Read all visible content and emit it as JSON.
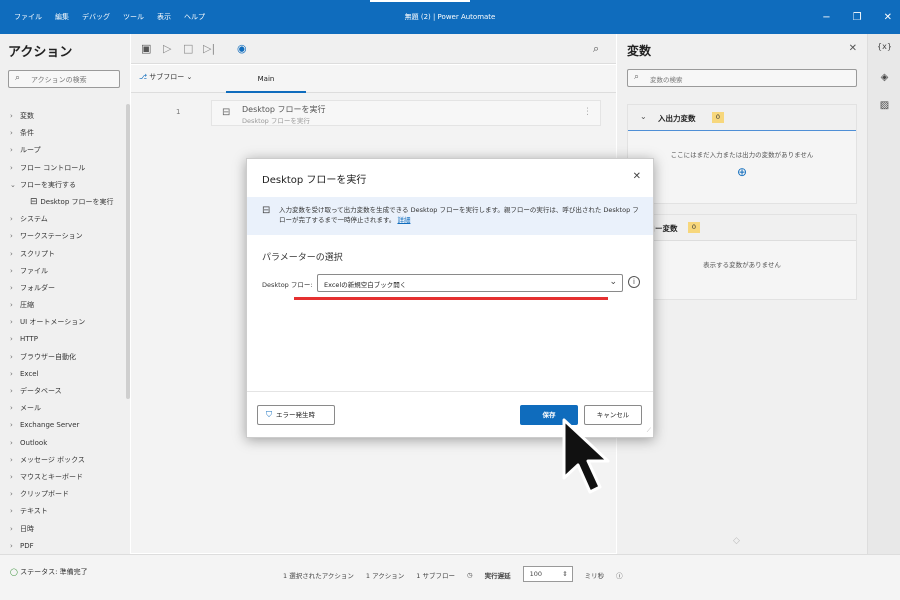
{
  "titlebar": {
    "menu": [
      "ファイル",
      "編集",
      "デバッグ",
      "ツール",
      "表示",
      "ヘルプ"
    ],
    "title": "無題 (2) | Power Automate",
    "controls": [
      "−",
      "❐",
      "✕"
    ]
  },
  "actions_panel": {
    "title": "アクション",
    "search_placeholder": "アクションの検索",
    "items": [
      {
        "label": "変数",
        "chev": "›"
      },
      {
        "label": "条件",
        "chev": "›"
      },
      {
        "label": "ループ",
        "chev": "›"
      },
      {
        "label": "フロー コントロール",
        "chev": "›"
      },
      {
        "label": "フローを実行する",
        "chev": "⌄"
      },
      {
        "label": "Desktop フローを実行",
        "chev": "",
        "sub": true
      },
      {
        "label": "システム",
        "chev": "›"
      },
      {
        "label": "ワークステーション",
        "chev": "›"
      },
      {
        "label": "スクリプト",
        "chev": "›"
      },
      {
        "label": "ファイル",
        "chev": "›"
      },
      {
        "label": "フォルダー",
        "chev": "›"
      },
      {
        "label": "圧縮",
        "chev": "›"
      },
      {
        "label": "UI オートメーション",
        "chev": "›"
      },
      {
        "label": "HTTP",
        "chev": "›"
      },
      {
        "label": "ブラウザー自動化",
        "chev": "›"
      },
      {
        "label": "Excel",
        "chev": "›"
      },
      {
        "label": "データベース",
        "chev": "›"
      },
      {
        "label": "メール",
        "chev": "›"
      },
      {
        "label": "Exchange Server",
        "chev": "›"
      },
      {
        "label": "Outlook",
        "chev": "›"
      },
      {
        "label": "メッセージ ボックス",
        "chev": "›"
      },
      {
        "label": "マウスとキーボード",
        "chev": "›"
      },
      {
        "label": "クリップボード",
        "chev": "›"
      },
      {
        "label": "テキスト",
        "chev": "›"
      },
      {
        "label": "日時",
        "chev": "›"
      },
      {
        "label": "PDF",
        "chev": "›"
      }
    ]
  },
  "editor": {
    "subflow_label": "サブフロー",
    "tab_main": "Main",
    "line_number": "1",
    "step_title": "Desktop フローを実行",
    "step_subtitle": "Desktop フローを実行"
  },
  "variables_panel": {
    "title": "変数",
    "search_placeholder": "変数の検索",
    "io_section": {
      "label": "入出力変数",
      "count": "0",
      "empty": "ここにはまだ入力または出力の変数がありません"
    },
    "flow_section": {
      "label": "フロー変数",
      "count": "0",
      "empty": "表示する変数がありません"
    }
  },
  "rail": {
    "vars_label": "{x}"
  },
  "statusbar": {
    "status": "ステータス: 準備完了",
    "selected": "1 選択されたアクション",
    "actions": "1 アクション",
    "subflows": "1 サブフロー",
    "delay_label": "実行遅延",
    "delay_value": "100",
    "unit": "ミリ秒"
  },
  "dialog": {
    "title": "Desktop フローを実行",
    "info_text": "入力変数を受け取って出力変数を生成できる Desktop フローを実行します。親フローの実行は、呼び出された Desktop フローが完了するまで一時停止されます。",
    "info_link": "詳細",
    "params_heading": "パラメーターの選択",
    "field_label": "Desktop フロー:",
    "field_value": "Excelの新規空白ブック開く",
    "error_button": "エラー発生時",
    "save_button": "保存",
    "cancel_button": "キャンセル"
  },
  "colors": {
    "accent": "#0f6cbd",
    "highlight": "#e53030",
    "badge": "#f7d77c"
  }
}
